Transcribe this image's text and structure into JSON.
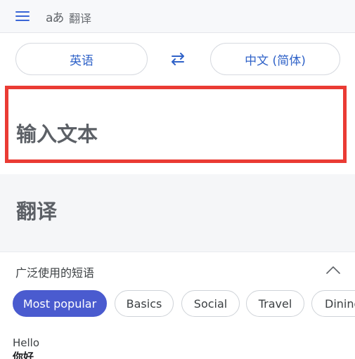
{
  "appbar": {
    "logo_text": "aあ",
    "title": "翻译",
    "icons": [
      "menu-icon",
      "translate-logo-icon"
    ]
  },
  "languages": {
    "source": "英语",
    "target": "中文 (简体)",
    "swap_icon": "swap-icon"
  },
  "input": {
    "placeholder": "输入文本",
    "highlight_color": "#ea3b34"
  },
  "output": {
    "label": "翻译"
  },
  "phrases": {
    "title": "广泛使用的短语",
    "toggle_icon": "chevron-up-icon",
    "chips": [
      {
        "label": "Most popular",
        "active": true
      },
      {
        "label": "Basics",
        "active": false
      },
      {
        "label": "Social",
        "active": false
      },
      {
        "label": "Travel",
        "active": false
      },
      {
        "label": "Dining",
        "active": false
      }
    ],
    "items": [
      {
        "source": "Hello",
        "target": "你好"
      }
    ]
  },
  "colors": {
    "accent": "#2f62c8",
    "chip_active": "#4a5bcf"
  }
}
